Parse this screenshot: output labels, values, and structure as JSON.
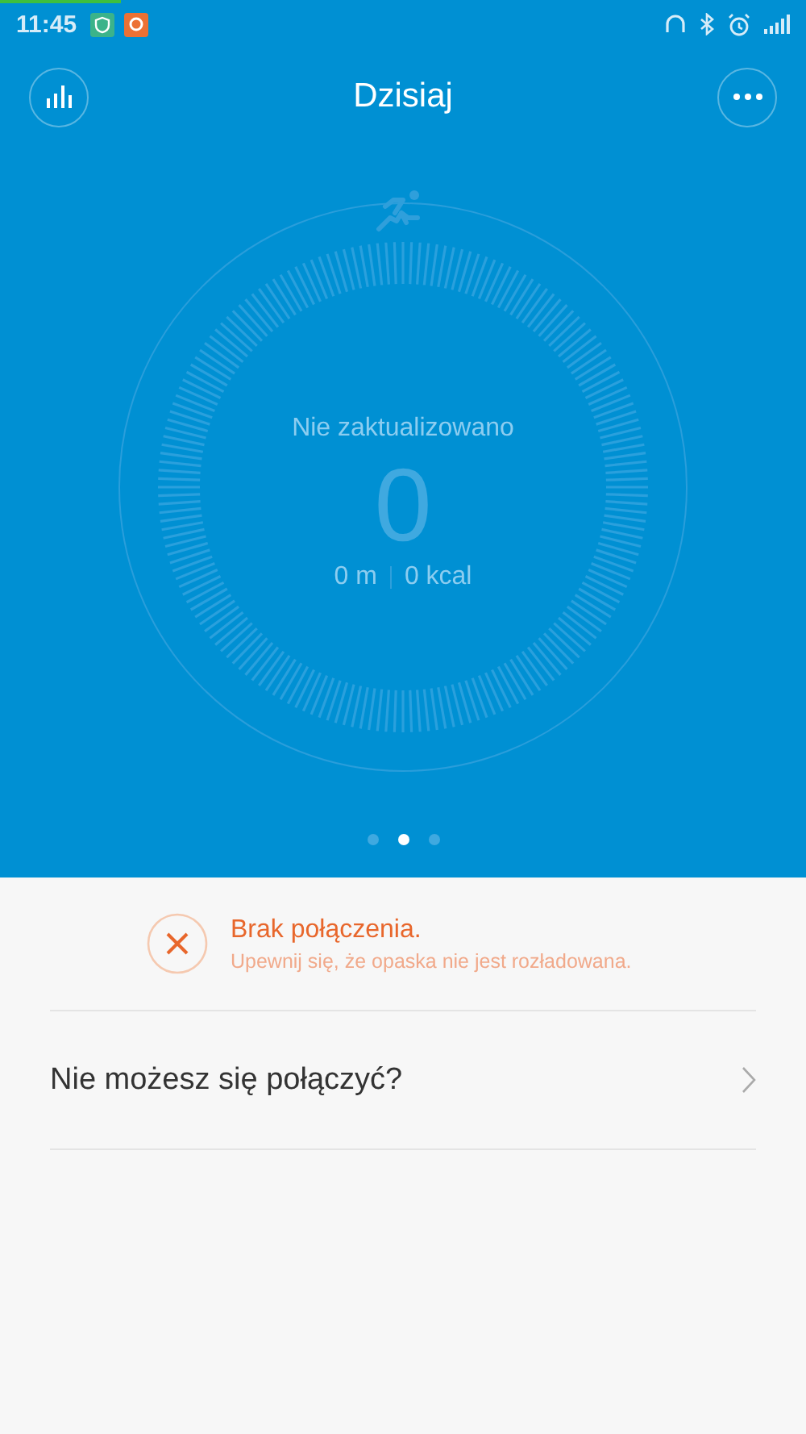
{
  "status_bar": {
    "time": "11:45"
  },
  "header": {
    "title": "Dzisiaj"
  },
  "dial": {
    "status": "Nie zaktualizowano",
    "steps": "0",
    "distance": "0 m",
    "calories": "0 kcal"
  },
  "pages": [
    {
      "selected": false
    },
    {
      "selected": true
    },
    {
      "selected": false
    }
  ],
  "alert": {
    "title": "Brak połączenia.",
    "message": "Upewnij się, że opaska nie jest rozładowana."
  },
  "help_row": {
    "label": "Nie możesz się połączyć?"
  }
}
